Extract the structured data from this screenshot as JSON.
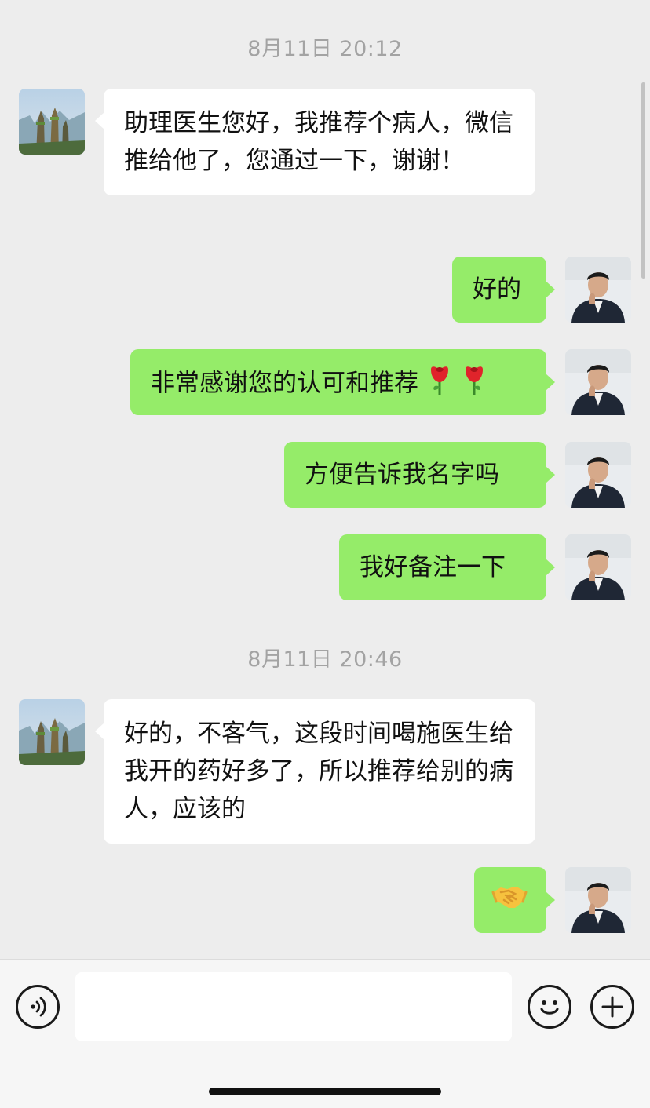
{
  "messages": [
    {
      "type": "timestamp",
      "text": "8月11日 20:12"
    },
    {
      "type": "incoming",
      "text": "助理医生您好，我推荐个病人，微信推给他了，您通过一下，谢谢！"
    },
    {
      "type": "outgoing",
      "text": "好的"
    },
    {
      "type": "outgoing",
      "text": "非常感谢您的认可和推荐",
      "emoji": [
        "rose-icon",
        "rose-icon"
      ]
    },
    {
      "type": "outgoing",
      "text": "方便告诉我名字吗"
    },
    {
      "type": "outgoing",
      "text": "我好备注一下"
    },
    {
      "type": "timestamp",
      "text": "8月11日 20:46"
    },
    {
      "type": "incoming",
      "text": "好的，不客气，这段时间喝施医生给我开的药好多了，所以推荐给别的病人，应该的"
    },
    {
      "type": "outgoing",
      "emoji": [
        "handshake-icon"
      ]
    }
  ],
  "input_bar": {
    "voice_icon": "voice-icon",
    "input_value": "",
    "emoji_icon": "emoji-icon",
    "plus_icon": "plus-icon"
  },
  "colors": {
    "background": "#ededed",
    "incoming_bubble": "#ffffff",
    "outgoing_bubble": "#95ec69",
    "timestamp_text": "#a3a3a3"
  }
}
